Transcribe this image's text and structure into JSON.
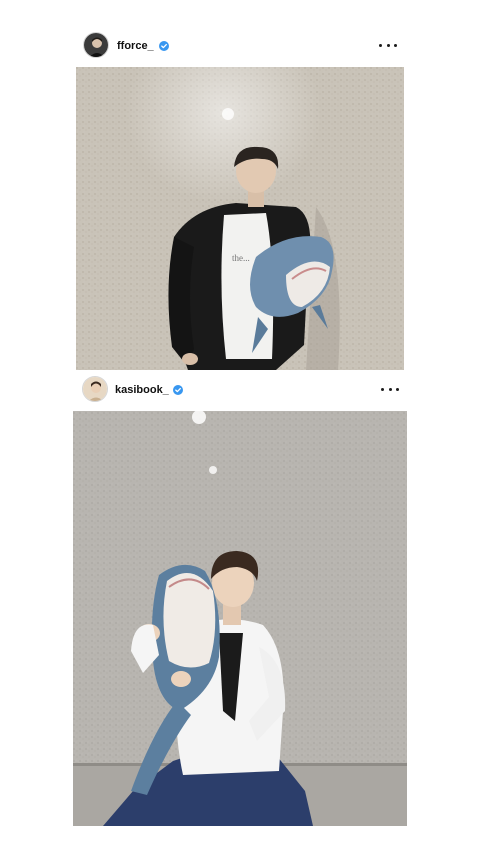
{
  "posts": [
    {
      "username": "fforce_",
      "verified": true,
      "avatar_icon": "profile-photo-icon",
      "more_icon": "more-options-icon",
      "photo_description_colors": {
        "wall": "#c9c3b8",
        "jacket": "#1a1a1a",
        "shirt": "#f2f2f0",
        "shark_body": "#6f8fae",
        "shark_belly": "#eeeae6",
        "hair": "#2a2420"
      }
    },
    {
      "username": "kasibook_",
      "verified": true,
      "avatar_icon": "profile-photo-icon",
      "more_icon": "more-options-icon",
      "photo_description_colors": {
        "wall": "#b8b5b0",
        "shirt": "#f5f5f5",
        "tie": "#1b1b1b",
        "pants": "#2c3e6b",
        "shark_body": "#5c7f9f",
        "shark_belly": "#f0ebe6",
        "hair": "#3a2a20"
      }
    }
  ],
  "colors": {
    "verified_badge": "#3897f0",
    "text": "#111111"
  }
}
